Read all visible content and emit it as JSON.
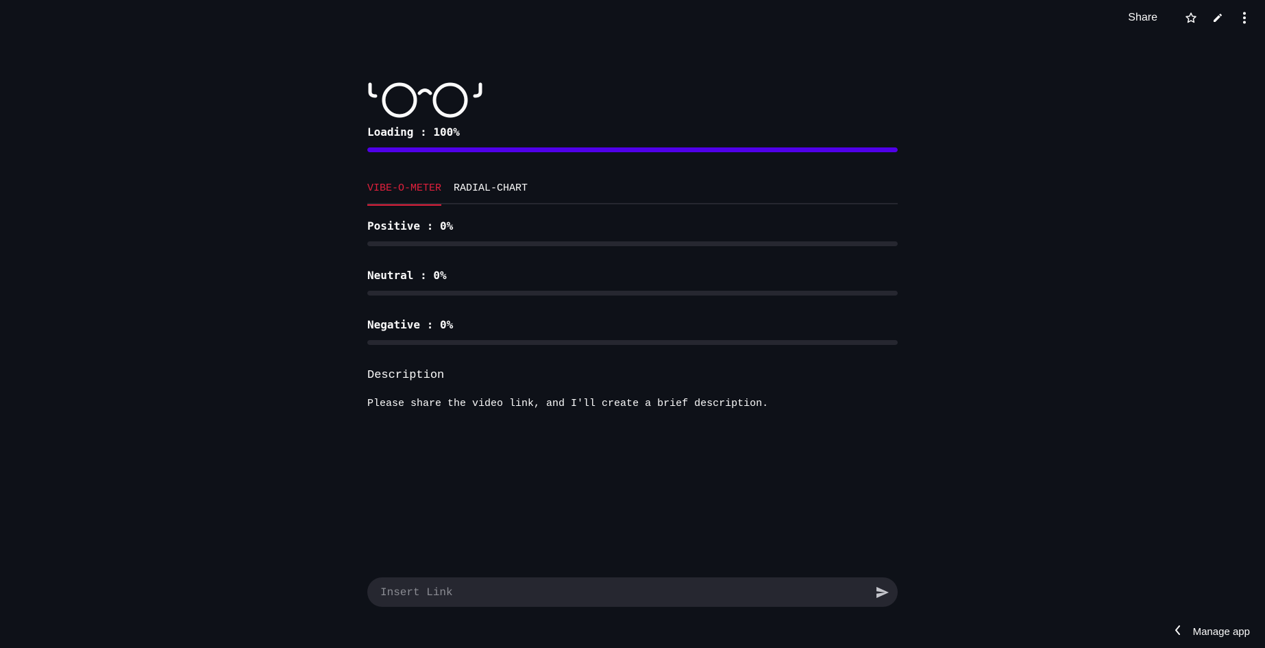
{
  "toolbar": {
    "share_label": "Share",
    "icons": [
      "star-icon",
      "pencil-icon",
      "more-vertical-icon"
    ]
  },
  "loading": {
    "label": "Loading : 100%",
    "value_percent": 100,
    "color": "#5000e8"
  },
  "tabs": [
    {
      "label": "VIBE-O-METER",
      "active": true
    },
    {
      "label": "RADIAL-CHART",
      "active": false
    }
  ],
  "meters": [
    {
      "label": "Positive : 0%",
      "value_percent": 0
    },
    {
      "label": "Neutral : 0%",
      "value_percent": 0
    },
    {
      "label": "Negative : 0%",
      "value_percent": 0
    }
  ],
  "description": {
    "heading": "Description",
    "text": "Please share the video link, and I'll create a brief description."
  },
  "chat": {
    "placeholder": "Insert Link",
    "value": ""
  },
  "footer": {
    "manage_label": "Manage app"
  },
  "colors": {
    "background": "#0e1118",
    "accent": "#e0203c",
    "progress": "#5000e8",
    "track": "#262730"
  }
}
